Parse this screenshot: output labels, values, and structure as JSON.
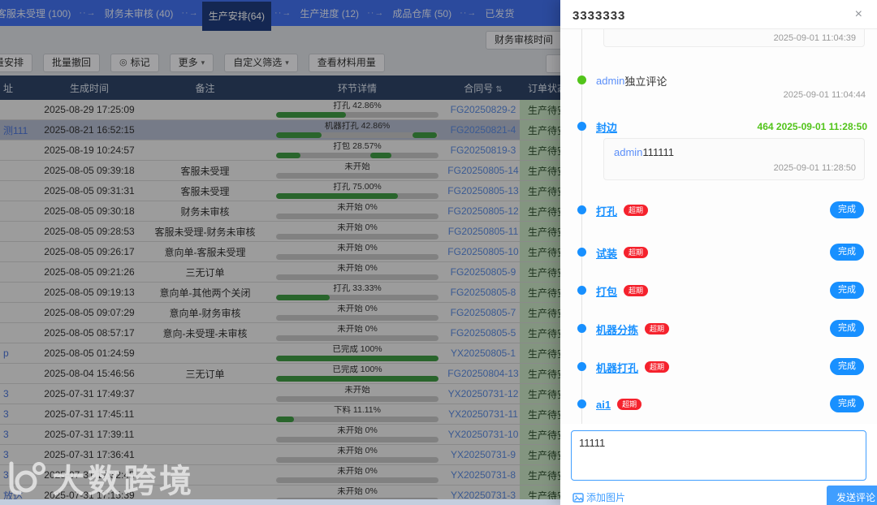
{
  "nav": {
    "separator": "··→",
    "tabs": [
      {
        "label": "客服未受理 (100)",
        "active": false
      },
      {
        "label": "财务未审核 (40)",
        "active": false
      },
      {
        "label": "生产安排(64)",
        "active": true
      },
      {
        "label": "生产进度 (12)",
        "active": false
      },
      {
        "label": "成品仓库 (50)",
        "active": false
      },
      {
        "label": "已发货",
        "active": false
      }
    ]
  },
  "subheader": {
    "finance_time_button": "财务审核时间"
  },
  "toolbar": {
    "buttons": [
      {
        "label": "量安排",
        "icon": "",
        "caret": false
      },
      {
        "label": "批量撤回",
        "icon": "",
        "caret": false
      },
      {
        "label": "标记",
        "icon": "◎",
        "caret": false
      },
      {
        "label": "更多",
        "icon": "",
        "caret": true
      },
      {
        "label": "自定义筛选",
        "icon": "",
        "caret": true
      },
      {
        "label": "查看材料用量",
        "icon": "",
        "caret": false
      }
    ]
  },
  "table": {
    "columns": [
      "址",
      "生成时间",
      "备注",
      "环节详情",
      "合同号",
      "订单状态"
    ],
    "sort_icon": "⇅",
    "rows": [
      {
        "name": "",
        "time": "2025-08-29 17:25:09",
        "remark": "",
        "stage": "打孔 42.86%",
        "seg": [
          [
            0,
            43
          ]
        ],
        "contract": "FG20250829-2",
        "status": "生产待安排",
        "selected": false
      },
      {
        "name": "测111",
        "time": "2025-08-21 16:52:15",
        "remark": "",
        "stage": "机器打孔 42.86%",
        "seg": [
          [
            0,
            28
          ],
          [
            84,
            15
          ]
        ],
        "contract": "FG20250821-4",
        "status": "生产待安排",
        "selected": true
      },
      {
        "name": "",
        "time": "2025-08-19 10:24:57",
        "remark": "",
        "stage": "打包 28.57%",
        "seg": [
          [
            0,
            15
          ],
          [
            58,
            13
          ]
        ],
        "contract": "FG20250819-3",
        "status": "生产待安排",
        "selected": false
      },
      {
        "name": "",
        "time": "2025-08-05 09:39:18",
        "remark": "客服未受理",
        "stage": "未开始",
        "seg": [],
        "contract": "FG20250805-14",
        "status": "生产待安排",
        "selected": false
      },
      {
        "name": "",
        "time": "2025-08-05 09:31:31",
        "remark": "客服未受理",
        "stage": "打孔 75.00%",
        "seg": [
          [
            0,
            75
          ]
        ],
        "contract": "FG20250805-13",
        "status": "生产待安排",
        "selected": false
      },
      {
        "name": "",
        "time": "2025-08-05 09:30:18",
        "remark": "财务未审核",
        "stage": "未开始 0%",
        "seg": [],
        "contract": "FG20250805-12",
        "status": "生产待安排",
        "selected": false
      },
      {
        "name": "",
        "time": "2025-08-05 09:28:53",
        "remark": "客服未受理-财务未审核",
        "stage": "未开始 0%",
        "seg": [],
        "contract": "FG20250805-11",
        "status": "生产待安排",
        "selected": false
      },
      {
        "name": "",
        "time": "2025-08-05 09:26:17",
        "remark": "意向单-客服未受理",
        "stage": "未开始 0%",
        "seg": [],
        "contract": "FG20250805-10",
        "status": "生产待安排",
        "selected": false
      },
      {
        "name": "",
        "time": "2025-08-05 09:21:26",
        "remark": "三无订单",
        "stage": "未开始 0%",
        "seg": [],
        "contract": "FG20250805-9",
        "status": "生产待安排",
        "selected": false
      },
      {
        "name": "",
        "time": "2025-08-05 09:19:13",
        "remark": "意向单-其他两个关闭",
        "stage": "打孔 33.33%",
        "seg": [
          [
            0,
            33
          ]
        ],
        "contract": "FG20250805-8",
        "status": "生产待安排",
        "selected": false
      },
      {
        "name": "",
        "time": "2025-08-05 09:07:29",
        "remark": "意向单-财务审核",
        "stage": "未开始 0%",
        "seg": [],
        "contract": "FG20250805-7",
        "status": "生产待安排",
        "selected": false
      },
      {
        "name": "",
        "time": "2025-08-05 08:57:17",
        "remark": "意向-未受理-未审核",
        "stage": "未开始 0%",
        "seg": [],
        "contract": "FG20250805-5",
        "status": "生产待安排",
        "selected": false
      },
      {
        "name": "p",
        "time": "2025-08-05 01:24:59",
        "remark": "",
        "stage": "已完成 100%",
        "seg": [
          [
            0,
            100
          ]
        ],
        "contract": "YX20250805-1",
        "status": "生产待安排",
        "selected": false
      },
      {
        "name": "",
        "time": "2025-08-04 15:46:56",
        "remark": "三无订单",
        "stage": "已完成 100%",
        "seg": [
          [
            0,
            100
          ]
        ],
        "contract": "FG20250804-13",
        "status": "生产待安排",
        "selected": false
      },
      {
        "name": "3",
        "time": "2025-07-31 17:49:37",
        "remark": "",
        "stage": "未开始",
        "seg": [],
        "contract": "YX20250731-12",
        "status": "生产待安排",
        "selected": false
      },
      {
        "name": "3",
        "time": "2025-07-31 17:45:11",
        "remark": "",
        "stage": "下料 11.11%",
        "seg": [
          [
            0,
            11
          ]
        ],
        "contract": "YX20250731-11",
        "status": "生产待安排",
        "selected": false
      },
      {
        "name": "3",
        "time": "2025-07-31 17:39:11",
        "remark": "",
        "stage": "未开始 0%",
        "seg": [],
        "contract": "YX20250731-10",
        "status": "生产待安排",
        "selected": false
      },
      {
        "name": "3",
        "time": "2025-07-31 17:36:41",
        "remark": "",
        "stage": "未开始 0%",
        "seg": [],
        "contract": "YX20250731-9",
        "status": "生产待安排",
        "selected": false
      },
      {
        "name": "3",
        "time": "2025-07-31 17:32:45",
        "remark": "",
        "stage": "未开始 0%",
        "seg": [],
        "contract": "YX20250731-8",
        "status": "生产待安排",
        "selected": false
      },
      {
        "name": "放达",
        "time": "2025-07-31 17:15:39",
        "remark": "",
        "stage": "未开始 0%",
        "seg": [],
        "contract": "YX20250731-3",
        "status": "生产待安排",
        "selected": false
      }
    ]
  },
  "watermark": {
    "text": "大数跨境"
  },
  "drawer": {
    "title": "3333333",
    "close_icon": "×",
    "top_partial_comment": {
      "time": "2025-09-01 11:04:39"
    },
    "timeline": [
      {
        "type": "comment",
        "dot": "green",
        "author": "admin",
        "text": "独立评论",
        "time": "2025-09-01 11:04:44"
      },
      {
        "type": "step-comment",
        "dot": "blue",
        "label": "封边",
        "info": "464 2025-09-01 11:28:50",
        "comment_author": "admin",
        "comment_text": "111111",
        "comment_time": "2025-09-01 11:28:50"
      },
      {
        "type": "step",
        "dot": "blue",
        "label": "打孔",
        "badge": "超期",
        "button": "完成"
      },
      {
        "type": "step",
        "dot": "blue",
        "label": "试装",
        "badge": "超期",
        "button": "完成"
      },
      {
        "type": "step",
        "dot": "blue",
        "label": "打包",
        "badge": "超期",
        "button": "完成"
      },
      {
        "type": "step",
        "dot": "blue",
        "label": "机器分拣",
        "badge": "超期",
        "button": "完成"
      },
      {
        "type": "step",
        "dot": "blue",
        "label": "机器打孔",
        "badge": "超期",
        "button": "完成"
      },
      {
        "type": "step",
        "dot": "blue",
        "label": "ai1",
        "badge": "超期",
        "button": "完成"
      }
    ],
    "composer": {
      "value": "11111",
      "add_image_label": "添加图片",
      "send_label": "发送评论"
    }
  }
}
